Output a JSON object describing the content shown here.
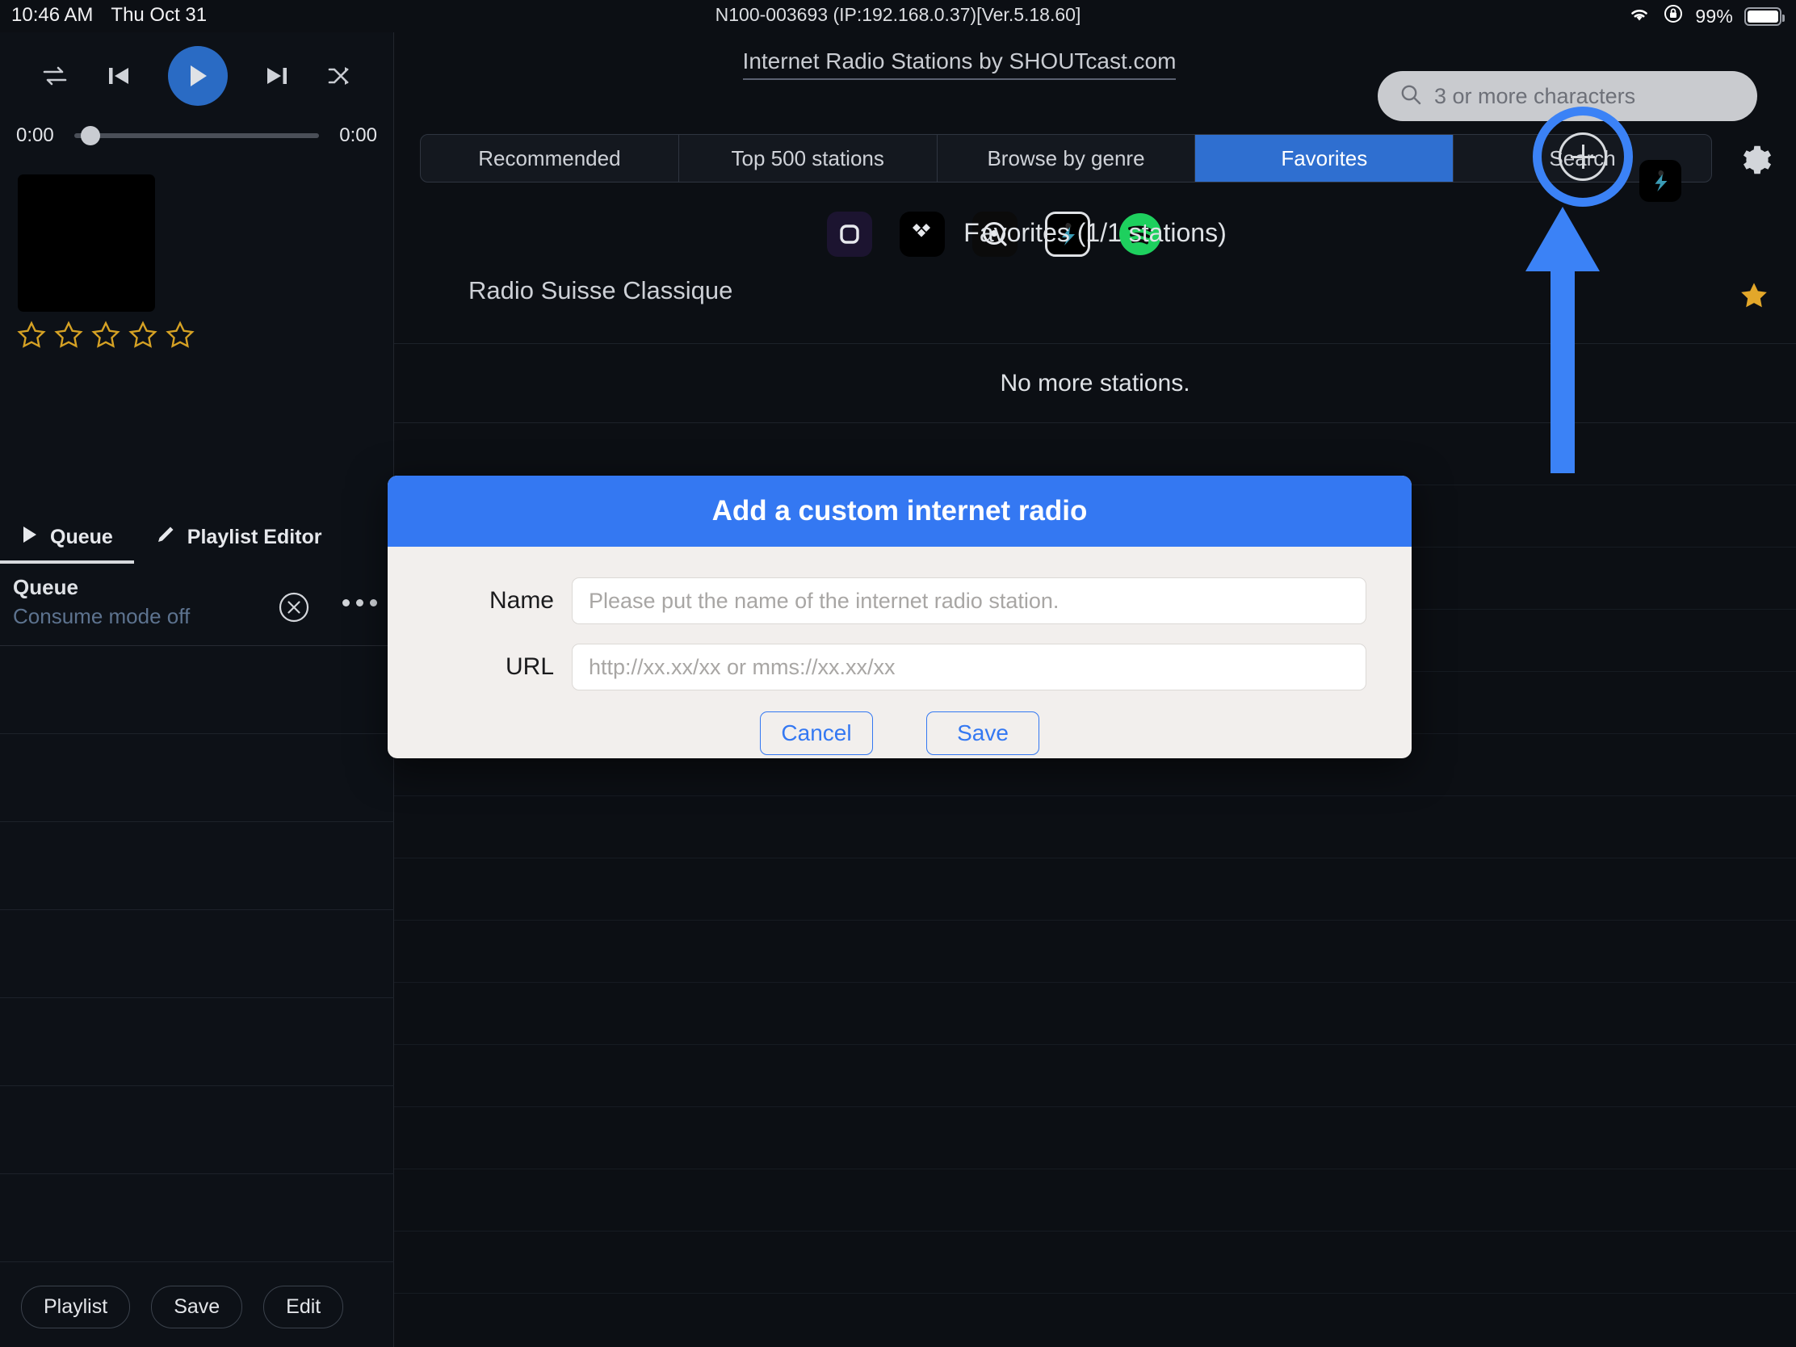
{
  "statusbar": {
    "time": "10:46 AM",
    "date": "Thu Oct 31",
    "device": "N100-003693 (IP:192.168.0.37)[Ver.5.18.60]",
    "battery_pct": "99%",
    "wifi_icon": "wifi-icon",
    "rotation_lock_icon": "rotation-lock-icon"
  },
  "player": {
    "repeat_icon": "repeat-icon",
    "previous_icon": "previous-track-icon",
    "play_icon": "play-icon",
    "next_icon": "next-track-icon",
    "shuffle_icon": "shuffle-icon",
    "elapsed": "0:00",
    "remaining": "0:00",
    "rating_stars": 5,
    "rating_filled": 0,
    "accent": "#2a6bc4"
  },
  "sidebar": {
    "tabs": [
      {
        "label": "Queue",
        "icon": "play-triangle-icon",
        "active": true
      },
      {
        "label": "Playlist Editor",
        "icon": "pencil-icon",
        "active": false
      }
    ],
    "queue_title": "Queue",
    "queue_subtitle": "Consume mode off",
    "clear_icon": "clear-circle-x-icon",
    "more_icon": "more-options-icon",
    "bottom_buttons": [
      "Playlist",
      "Save",
      "Edit"
    ]
  },
  "header": {
    "app_title": "Internet Radio Stations by SHOUTcast.com"
  },
  "search": {
    "placeholder": "3 or more characters",
    "value": "",
    "icon": "search-icon"
  },
  "tabs": [
    {
      "label": "Recommended",
      "active": false
    },
    {
      "label": "Top 500 stations",
      "active": false
    },
    {
      "label": "Browse by genre",
      "active": false
    },
    {
      "label": "Favorites",
      "active": true
    },
    {
      "label": "Search",
      "active": false
    }
  ],
  "settings_icon": "gear-icon",
  "services": [
    {
      "name": "qobuz-icon",
      "selected": false
    },
    {
      "name": "tidal-icon",
      "selected": false
    },
    {
      "name": "deezer-icon",
      "selected": false
    },
    {
      "name": "shoutcast-icon",
      "selected": true
    },
    {
      "name": "spotify-icon",
      "selected": false
    }
  ],
  "content": {
    "favorites_title": "Favorites (1/1 stations)",
    "station_name": "Radio Suisse Classique",
    "station_star_icon": "favorite-star-icon",
    "shoutcast_badge_icon": "shoutcast-icon",
    "no_more": "No more stations.",
    "add_button_icon": "add-plus-icon"
  },
  "annotation": {
    "ring_color": "#3b82f6",
    "arrow_color": "#3b82f6",
    "target": "add-custom-radio-button"
  },
  "dialog": {
    "title": "Add a custom internet radio",
    "fields": [
      {
        "label": "Name",
        "placeholder": "Please put the name of the internet radio station.",
        "value": ""
      },
      {
        "label": "URL",
        "placeholder": "http://xx.xx/xx or mms://xx.xx/xx",
        "value": ""
      }
    ],
    "cancel_label": "Cancel",
    "save_label": "Save",
    "header_color": "#3478f2",
    "body_color": "#f2efed"
  }
}
